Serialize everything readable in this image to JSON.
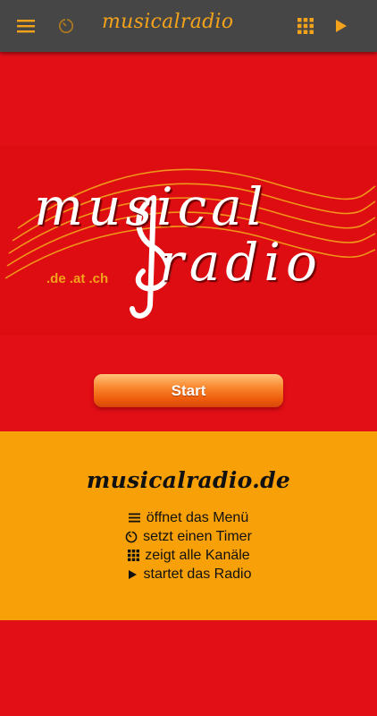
{
  "appbar": {
    "title": "musicalradio",
    "menu_icon": "menu-icon",
    "timer_icon": "timer-icon",
    "channels_icon": "grid-icon",
    "play_icon": "play-icon",
    "accent_color": "#f3a31b",
    "background_color": "#464646"
  },
  "logo": {
    "word_top": "musical",
    "word_bottom": "radio",
    "domains": ".de .at .ch"
  },
  "start_button": {
    "label": "Start"
  },
  "info": {
    "title": "musicalradio.de",
    "legend": [
      {
        "icon": "menu-icon",
        "text": "öffnet das Menü"
      },
      {
        "icon": "timer-icon",
        "text": "setzt einen Timer"
      },
      {
        "icon": "grid-icon",
        "text": "zeigt alle Kanäle"
      },
      {
        "icon": "play-icon",
        "text": "startet das Radio"
      }
    ]
  },
  "colors": {
    "background_red": "#e30f17",
    "panel_orange": "#f7a008"
  }
}
